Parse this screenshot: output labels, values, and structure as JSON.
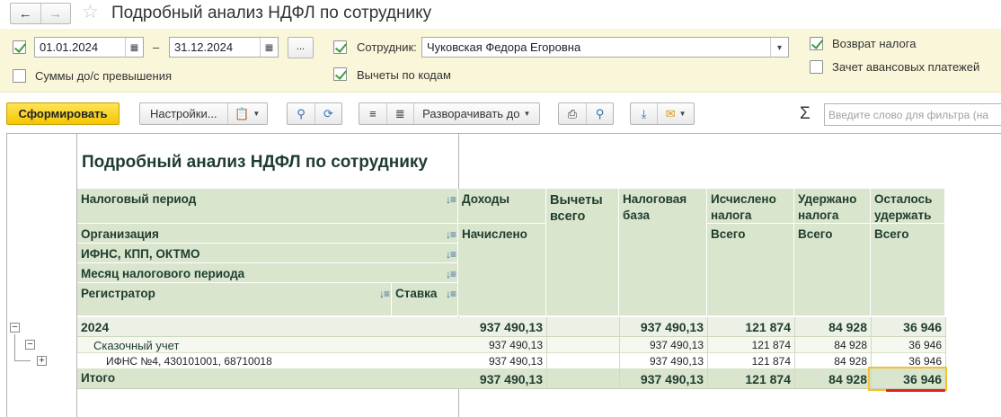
{
  "window": {
    "title": "Подробный анализ НДФЛ по сотруднику",
    "back_icon": "arrow-left-icon",
    "forward_icon": "arrow-right-icon",
    "favorite_icon": "star-icon"
  },
  "filters": {
    "period_from": "01.01.2024",
    "period_sep": "–",
    "period_to": "31.12.2024",
    "dots_label": "...",
    "employee_label": "Сотрудник:",
    "employee_value": "Чуковская Федора Егоровна",
    "refund_label": "Возврат налога",
    "excess_label": "Суммы до/с превышения",
    "deductions_label": "Вычеты по кодам",
    "advance_label": "Зачет авансовых платежей"
  },
  "toolbar": {
    "generate_label": "Сформировать",
    "settings_label": "Настройки...",
    "expand_label": "Разворачивать до",
    "search_placeholder": "Введите слово для фильтра (на",
    "sigma": "Σ"
  },
  "report": {
    "title": "Подробный анализ НДФЛ по сотруднику",
    "group_headers": {
      "period": "Налоговый период",
      "org": "Организация",
      "ifns": "ИФНС, КПП, ОКТМО",
      "month": "Месяц налогового периода",
      "registrar": "Регистратор",
      "rate": "Ставка"
    },
    "columns": {
      "income": "Доходы",
      "income_sub": "Начислено",
      "deductions": "Вычеты всего",
      "base": "Налоговая база",
      "calc": "Исчислено налога",
      "calc_sub": "Всего",
      "withheld": "Удержано налога",
      "withheld_sub": "Всего",
      "remain": "Осталось удержать",
      "remain_sub": "Всего"
    },
    "rows": [
      {
        "label": "2024",
        "income": "937 490,13",
        "deductions": "",
        "base": "937 490,13",
        "calc": "121 874",
        "withheld": "84 928",
        "remain": "36 946"
      },
      {
        "label": "Сказочный учет",
        "income": "937 490,13",
        "deductions": "",
        "base": "937 490,13",
        "calc": "121 874",
        "withheld": "84 928",
        "remain": "36 946"
      },
      {
        "label": "ИФНС №4, 430101001, 68710018",
        "income": "937 490,13",
        "deductions": "",
        "base": "937 490,13",
        "calc": "121 874",
        "withheld": "84 928",
        "remain": "36 946"
      }
    ],
    "total": {
      "label": "Итого",
      "income": "937 490,13",
      "deductions": "",
      "base": "937 490,13",
      "calc": "121 874",
      "withheld": "84 928",
      "remain": "36 946"
    }
  },
  "colors": {
    "accent_yellow": "#f4c600",
    "header_green": "#d9e5cd",
    "highlight_outline": "#f2c233",
    "underline_red": "#e0211f"
  }
}
